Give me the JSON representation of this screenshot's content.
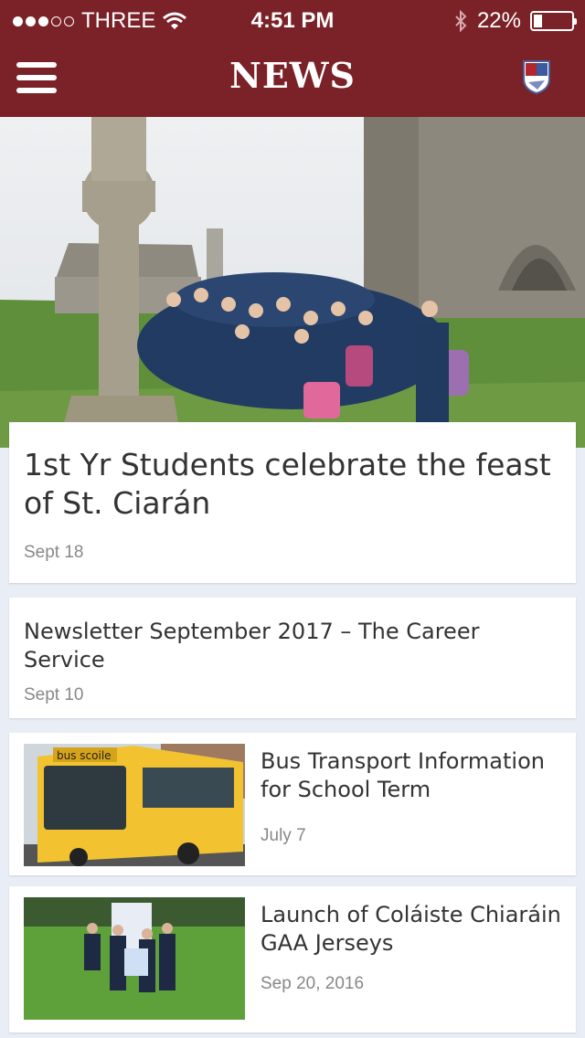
{
  "status_bar": {
    "carrier": "THREE",
    "time": "4:51 PM",
    "battery_text": "22%",
    "battery_level": 0.22
  },
  "header": {
    "title": "NEWS",
    "background_color": "#7a2227"
  },
  "featured": {
    "headline": "1st Yr Students celebrate the feast of St. Ciarán",
    "date": "Sept 18"
  },
  "articles": [
    {
      "headline": "Newsletter September 2017 – The Career Service",
      "date": "Sept 10"
    },
    {
      "headline": "Bus Transport Information for School Term",
      "date": "July 7",
      "thumb_text": "bus scoile"
    },
    {
      "headline": "Launch of Coláiste Chiaráin GAA Jerseys",
      "date": "Sep 20, 2016"
    }
  ],
  "icons": [
    "wifi-icon",
    "bluetooth-icon",
    "battery-icon",
    "menu-icon",
    "school-crest-icon"
  ]
}
